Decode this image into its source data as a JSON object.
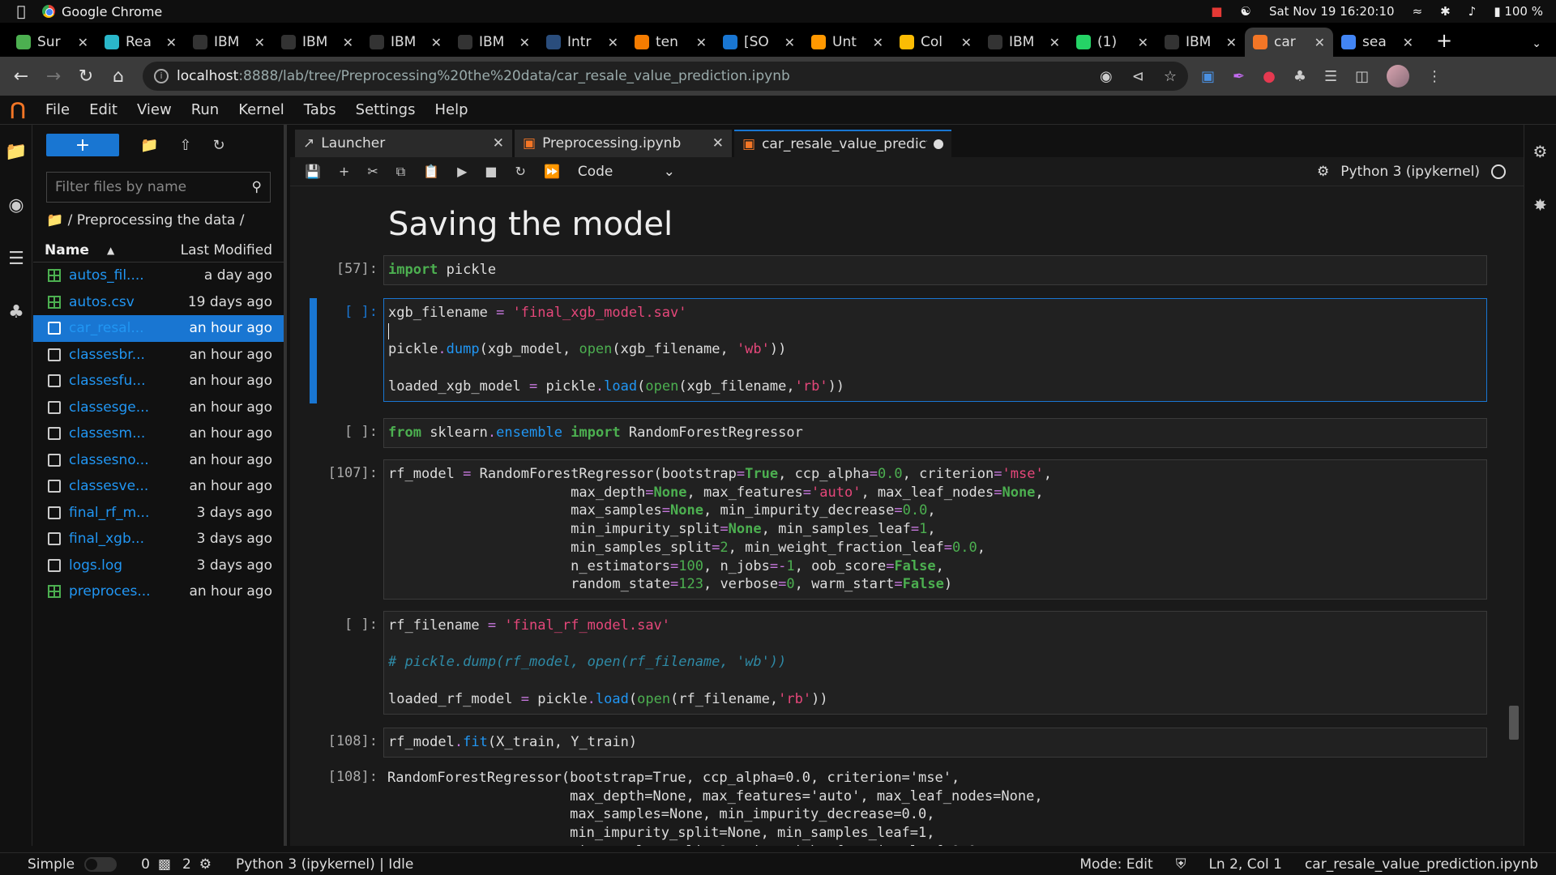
{
  "menubar": {
    "app_name": "Google Chrome",
    "datetime": "Sat Nov 19  16:20:10",
    "battery": "100 %"
  },
  "browser_tabs": [
    {
      "label": "Sur",
      "color": "#4caf50"
    },
    {
      "label": "Rea",
      "color": "#2ab7ca"
    },
    {
      "label": "IBM",
      "color": "#333333"
    },
    {
      "label": "IBM",
      "color": "#333333"
    },
    {
      "label": "IBM",
      "color": "#333333"
    },
    {
      "label": "IBM",
      "color": "#333333"
    },
    {
      "label": "Intr",
      "color": "#2a4d7c"
    },
    {
      "label": "ten",
      "color": "#f57c00"
    },
    {
      "label": "[SO",
      "color": "#1976d2"
    },
    {
      "label": "Unt",
      "color": "#ff9800"
    },
    {
      "label": "Col",
      "color": "#fbbc04"
    },
    {
      "label": "IBM",
      "color": "#333333"
    },
    {
      "label": "(1)",
      "color": "#25d366"
    },
    {
      "label": "IBM",
      "color": "#333333"
    },
    {
      "label": "car",
      "color": "#f37626"
    },
    {
      "label": "sea",
      "color": "#4285f4"
    }
  ],
  "address": {
    "host": "localhost",
    "path": ":8888/lab/tree/Preprocessing%20the%20data/car_resale_value_prediction.ipynb"
  },
  "jupyter_menu": [
    "File",
    "Edit",
    "View",
    "Run",
    "Kernel",
    "Tabs",
    "Settings",
    "Help"
  ],
  "filebrowser": {
    "search_placeholder": "Filter files by name",
    "breadcrumb": "/ Preprocessing the data /",
    "col_name": "Name",
    "col_modified": "Last Modified",
    "files": [
      {
        "name": "autos_fil....",
        "modified": "a day ago",
        "type": "csv"
      },
      {
        "name": "autos.csv",
        "modified": "19 days ago",
        "type": "csv"
      },
      {
        "name": "car_resal...",
        "modified": "an hour ago",
        "type": "sel-nb"
      },
      {
        "name": "classesbr...",
        "modified": "an hour ago",
        "type": "txt"
      },
      {
        "name": "classesfu...",
        "modified": "an hour ago",
        "type": "txt"
      },
      {
        "name": "classesge...",
        "modified": "an hour ago",
        "type": "txt"
      },
      {
        "name": "classesm...",
        "modified": "an hour ago",
        "type": "txt"
      },
      {
        "name": "classesno...",
        "modified": "an hour ago",
        "type": "txt"
      },
      {
        "name": "classesve...",
        "modified": "an hour ago",
        "type": "txt"
      },
      {
        "name": "final_rf_m...",
        "modified": "3 days ago",
        "type": "txt"
      },
      {
        "name": "final_xgb...",
        "modified": "3 days ago",
        "type": "txt"
      },
      {
        "name": "logs.log",
        "modified": "3 days ago",
        "type": "txt"
      },
      {
        "name": "preproces...",
        "modified": "an hour ago",
        "type": "csv"
      }
    ]
  },
  "doc_tabs": [
    {
      "label": "Launcher"
    },
    {
      "label": "Preprocessing.ipynb"
    },
    {
      "label": "car_resale_value_predictic"
    }
  ],
  "nbtoolbar": {
    "cell_type": "Code",
    "kernel": "Python 3 (ipykernel)"
  },
  "notebook": {
    "heading": "Saving the model",
    "prompts": [
      "[57]:",
      "[ ]:",
      "[ ]:",
      "[107]:",
      "[ ]:",
      "[108]:",
      "[108]:"
    ]
  },
  "statusbar": {
    "mode_label": "Simple",
    "count_a": "0",
    "count_b": "2",
    "kernel_status": "Python 3 (ipykernel) | Idle",
    "mode": "Mode: Edit",
    "position": "Ln 2, Col 1",
    "filename": "car_resale_value_prediction.ipynb"
  }
}
